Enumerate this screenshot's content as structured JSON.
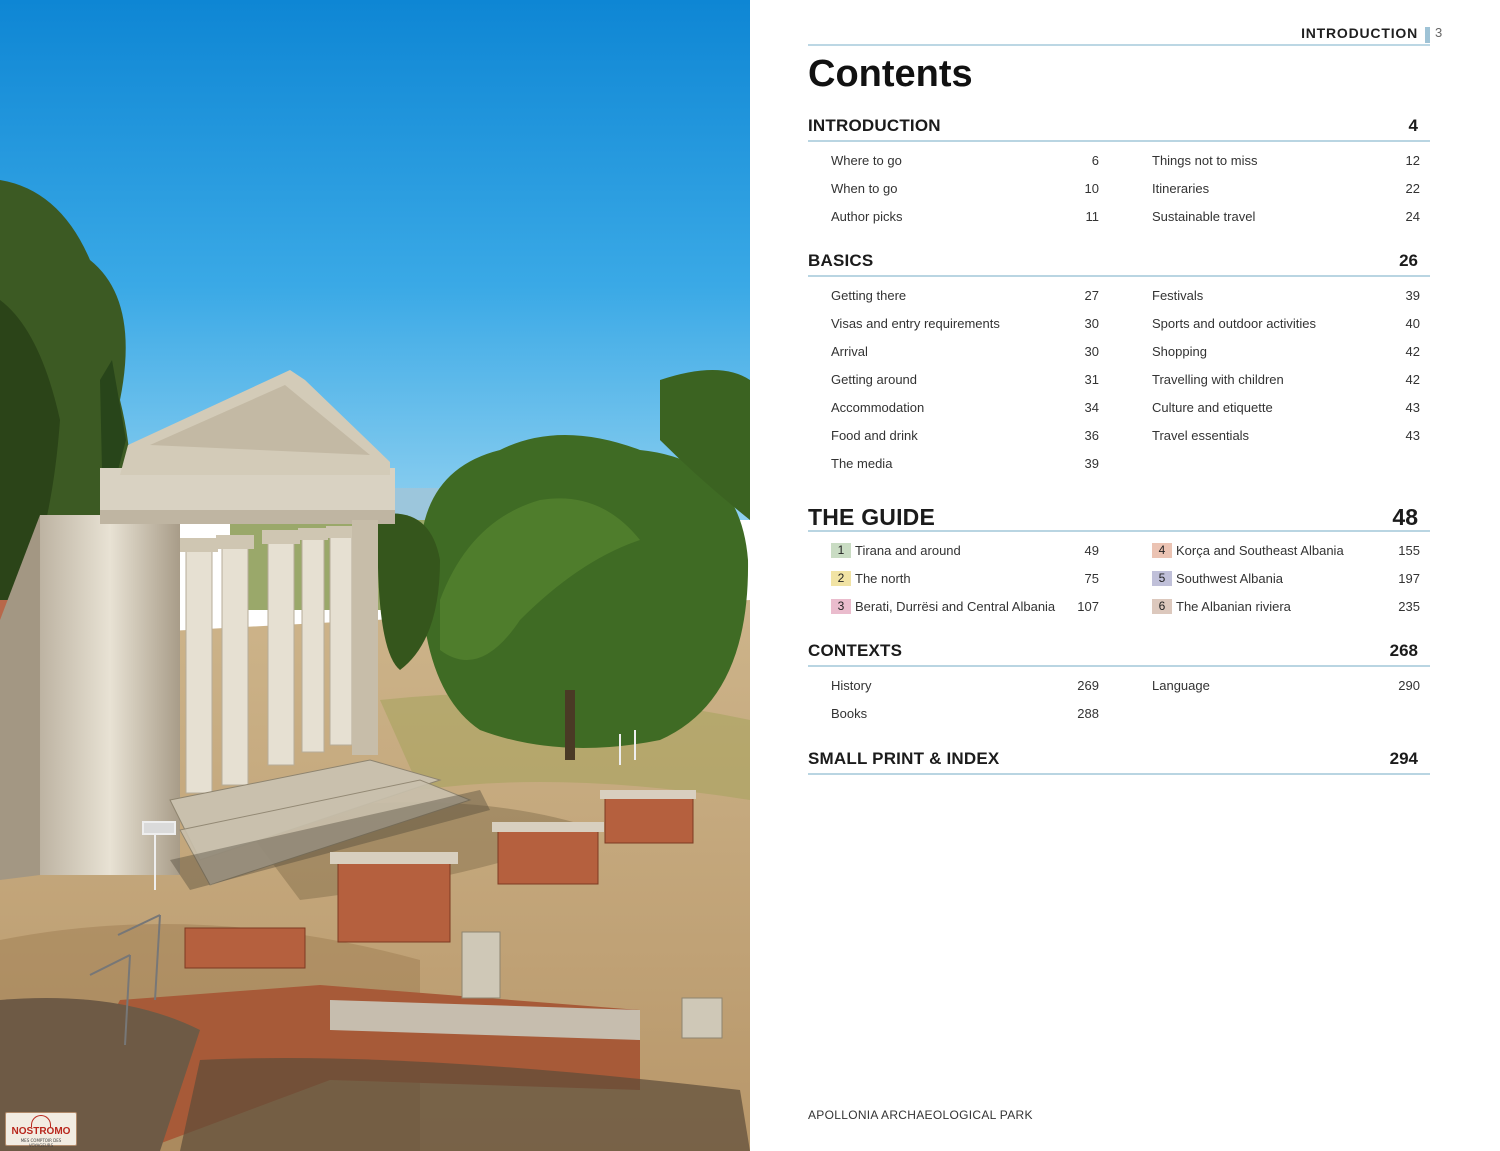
{
  "header": {
    "running_head": "INTRODUCTION",
    "folio": "3"
  },
  "title": "Contents",
  "sections": {
    "introduction": {
      "title": "INTRODUCTION",
      "page": "4",
      "left": [
        {
          "label": "Where to go",
          "page": "6"
        },
        {
          "label": "When to go",
          "page": "10"
        },
        {
          "label": "Author picks",
          "page": "11"
        }
      ],
      "right": [
        {
          "label": "Things not to miss",
          "page": "12"
        },
        {
          "label": "Itineraries",
          "page": "22"
        },
        {
          "label": "Sustainable travel",
          "page": "24"
        }
      ]
    },
    "basics": {
      "title": "BASICS",
      "page": "26",
      "left": [
        {
          "label": "Getting there",
          "page": "27"
        },
        {
          "label": "Visas and entry requirements",
          "page": "30"
        },
        {
          "label": "Arrival",
          "page": "30"
        },
        {
          "label": "Getting around",
          "page": "31"
        },
        {
          "label": "Accommodation",
          "page": "34"
        },
        {
          "label": "Food and drink",
          "page": "36"
        },
        {
          "label": "The media",
          "page": "39"
        }
      ],
      "right": [
        {
          "label": "Festivals",
          "page": "39"
        },
        {
          "label": "Sports and outdoor activities",
          "page": "40"
        },
        {
          "label": "Shopping",
          "page": "42"
        },
        {
          "label": "Travelling with children",
          "page": "42"
        },
        {
          "label": "Culture and etiquette",
          "page": "43"
        },
        {
          "label": "Travel essentials",
          "page": "43"
        }
      ]
    },
    "guide": {
      "title": "THE GUIDE",
      "page": "48",
      "left": [
        {
          "num": "1",
          "label": "Tirana and around",
          "page": "49",
          "color": "#c9dcc3"
        },
        {
          "num": "2",
          "label": "The north",
          "page": "75",
          "color": "#f1e3a4"
        },
        {
          "num": "3",
          "label": "Berati, Durrësi and Central Albania",
          "page": "107",
          "color": "#eabccd"
        }
      ],
      "right": [
        {
          "num": "4",
          "label": "Korça and Southeast Albania",
          "page": "155",
          "color": "#ebc3b3"
        },
        {
          "num": "5",
          "label": "Southwest Albania",
          "page": "197",
          "color": "#c0c0d9"
        },
        {
          "num": "6",
          "label": "The Albanian riviera",
          "page": "235",
          "color": "#dcc8bd"
        }
      ]
    },
    "contexts": {
      "title": "CONTEXTS",
      "page": "268",
      "left": [
        {
          "label": "History",
          "page": "269"
        },
        {
          "label": "Books",
          "page": "288"
        }
      ],
      "right": [
        {
          "label": "Language",
          "page": "290"
        }
      ]
    },
    "smallprint": {
      "title": "SMALL PRINT & INDEX",
      "page": "294"
    }
  },
  "caption": "APOLLONIA ARCHAEOLOGICAL PARK",
  "stamp": {
    "word": "NOSTROMO",
    "line": "MES COMPTOIR DES VOYAGEURS"
  }
}
